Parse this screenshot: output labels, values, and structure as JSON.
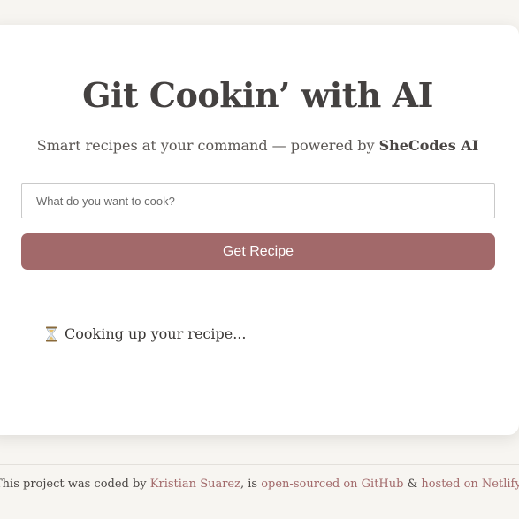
{
  "header": {
    "title": "Git Cookin’ with AI",
    "subtitle_prefix": "Smart recipes at your command — powered by",
    "subtitle_brand": "SheCodes AI"
  },
  "search": {
    "placeholder": "What do you want to cook?",
    "value": "",
    "button_label": "Get Recipe"
  },
  "status": {
    "icon": "hourglass-icon",
    "text": "Cooking up your recipe..."
  },
  "footer": {
    "text_1": "This project was coded by",
    "author_link": "Kristian Suarez",
    "text_2": ", is",
    "source_link": "open-sourced on GitHub",
    "text_3": "&",
    "host_link": "hosted on Netlify"
  },
  "colors": {
    "accent": "#a2696a",
    "background": "#f7f5f1",
    "card": "#ffffff",
    "title": "#444140"
  }
}
